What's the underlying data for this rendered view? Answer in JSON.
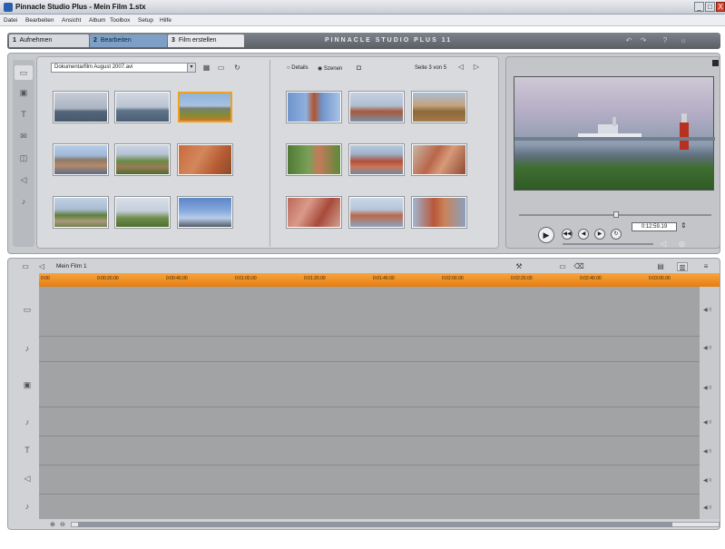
{
  "window": {
    "title": "Pinnacle Studio Plus - Mein Film 1.stx",
    "min": "_",
    "max": "□",
    "close": "X"
  },
  "menu": [
    "Datei",
    "Bearbeiten",
    "Ansicht",
    "Album",
    "Toolbox",
    "Setup",
    "Hilfe"
  ],
  "tabs": [
    {
      "num": "1",
      "label": "Aufnehmen"
    },
    {
      "num": "2",
      "label": "Bearbeiten"
    },
    {
      "num": "3",
      "label": "Film erstellen"
    }
  ],
  "brand": "PINNACLE STUDIO PLUS 11",
  "header_icons": [
    "undo-icon",
    "redo-icon",
    "help-icon",
    "bulb-icon"
  ],
  "album": {
    "source_dropdown": "Dokumentarfilm August 2007.avi",
    "view_options": {
      "details": "Details",
      "scenes": "Szenen"
    },
    "page_info": "Seite 3 von 5"
  },
  "preview": {
    "timecode": "0:12:59.19"
  },
  "timeline": {
    "project_name": "Mein Film 1",
    "ruler_ticks": [
      "0:00",
      "0:00:20.00",
      "0:00:40.00",
      "0:01:00.00",
      "0:01:20.00",
      "0:01:40.00",
      "0:02:00.00",
      "0:02:20.00",
      "0:02:40.00",
      "0:03:00.00"
    ]
  },
  "colors": {
    "accent_tab": "#7ea0c7",
    "ruler": "#f29a2a",
    "selection": "#f0a020"
  }
}
